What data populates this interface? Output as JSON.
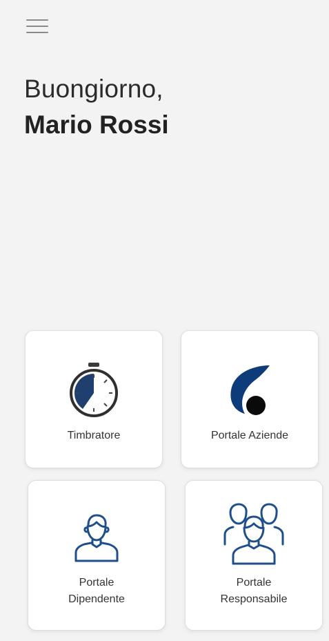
{
  "header": {
    "greeting": "Buongiorno,",
    "user_name": "Mario Rossi"
  },
  "tiles": [
    {
      "label_lines": [
        "Timbratore"
      ],
      "icon": "stopwatch-icon"
    },
    {
      "label_lines": [
        "Portale Aziende"
      ],
      "icon": "company-logo-icon"
    },
    {
      "label_lines": [
        "Portale",
        "Dipendente"
      ],
      "icon": "user-icon"
    },
    {
      "label_lines": [
        "Portale",
        "Responsabile"
      ],
      "icon": "users-group-icon"
    }
  ],
  "colors": {
    "background": "#f3f3f3",
    "accent_navy": "#0e3c7a",
    "icon_blue": "#1f4e8c"
  }
}
